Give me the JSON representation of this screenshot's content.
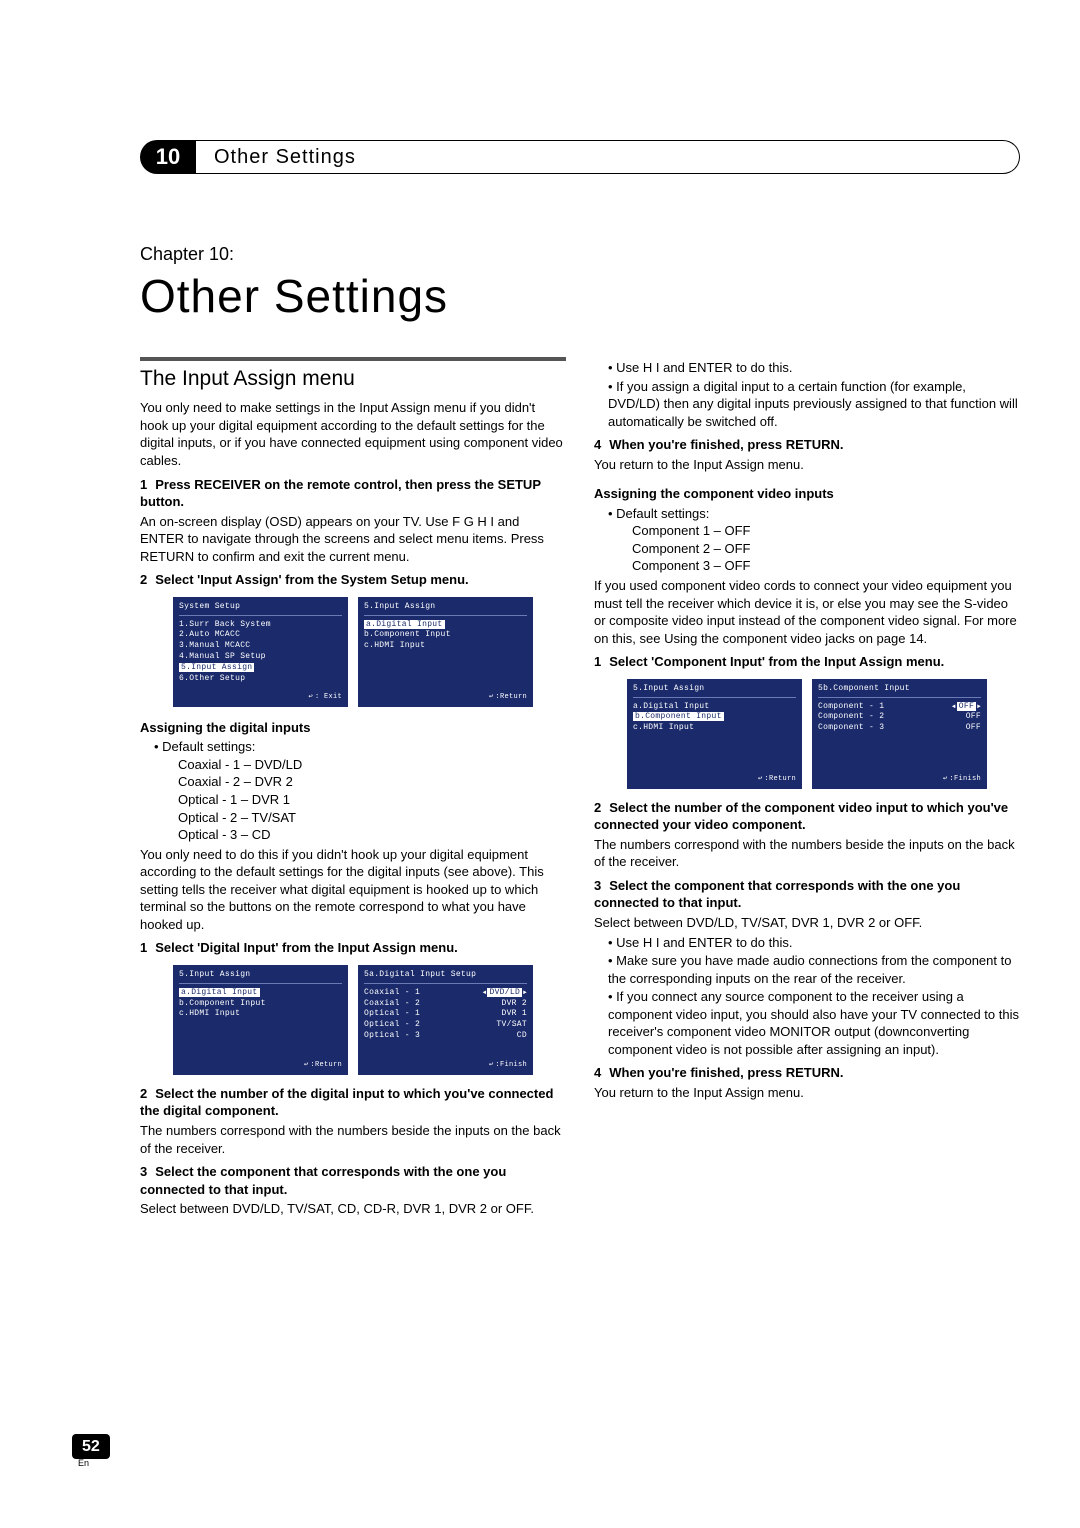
{
  "chapter": {
    "number": "10",
    "tab_label": "Other Settings",
    "pre": "Chapter 10:",
    "title": "Other Settings"
  },
  "left": {
    "section_title": "The Input Assign menu",
    "intro": "You only need to make settings in the Input Assign menu if you didn't hook up your digital equipment according to the default settings for the digital inputs, or if you have connected equipment using component video cables.",
    "step1_num": "1",
    "step1_text": "Press RECEIVER on the remote control, then press the SETUP button.",
    "step1_body": "An on-screen display (OSD) appears on your TV. Use F G H I and ENTER to navigate through the screens and select menu items. Press RETURN to confirm and exit the current menu.",
    "step2_num": "2",
    "step2_text": "Select 'Input Assign' from the System Setup menu.",
    "osd1a_title": "System Setup",
    "osd1a_lines": [
      "1.Surr Back System",
      "2.Auto MCACC",
      "3.Manual MCACC",
      "4.Manual SP Setup",
      "5.Input Assign",
      "6.Other Setup"
    ],
    "osd1a_footer": ": Exit",
    "osd1b_title": "5.Input Assign",
    "osd1b_lines": [
      "a.Digital Input",
      "b.Component Input",
      "c.HDMI Input"
    ],
    "osd1b_footer": ":Return",
    "sub1": "Assigning the digital inputs",
    "defaults_label": "Default settings:",
    "defaults": [
      "Coaxial - 1 – DVD/LD",
      "Coaxial - 2 – DVR 2",
      "Optical - 1 – DVR 1",
      "Optical - 2 – TV/SAT",
      "Optical - 3 – CD"
    ],
    "afterdef": "You only need to do this if you didn't hook up your digital equipment according to the default settings for the digital inputs (see above). This setting tells the receiver what digital equipment is hooked up to which terminal so the buttons on the remote correspond to what you have hooked up.",
    "dstep1_num": "1",
    "dstep1_text": "Select 'Digital Input' from the Input Assign menu.",
    "osd2a_title": "5.Input Assign",
    "osd2a_lines": [
      "a.Digital Input",
      "b.Component Input",
      "c.HDMI Input"
    ],
    "osd2a_footer": ":Return",
    "osd2b_title": "5a.Digital Input Setup",
    "osd2b_rows": [
      {
        "l": "Coaxial - 1",
        "r": "DVD/LD",
        "hl": true
      },
      {
        "l": "Coaxial - 2",
        "r": "DVR 2"
      },
      {
        "l": "Optical - 1",
        "r": "DVR 1"
      },
      {
        "l": "Optical - 2",
        "r": "TV/SAT"
      },
      {
        "l": "Optical - 3",
        "r": "CD"
      }
    ],
    "osd2b_footer": ":Finish",
    "dstep2_num": "2",
    "dstep2_text": "Select the number of the digital input to which you've connected the digital component.",
    "dstep2_body": "The numbers correspond with the numbers beside the inputs on the back of the receiver.",
    "dstep3_num": "3",
    "dstep3_text": "Select the component that corresponds with the one you connected to that input.",
    "dstep3_body": "Select between DVD/LD, TV/SAT, CD, CD-R, DVR 1, DVR 2 or OFF."
  },
  "right": {
    "bul1": "Use H I and ENTER to do this.",
    "bul2": "If you assign a digital input to a certain function (for example, DVD/LD) then any digital inputs previously assigned to that function will automatically be switched off.",
    "step4_num": "4",
    "step4_text": "When you're finished, press RETURN.",
    "step4_body": "You return to the Input Assign menu.",
    "sub2": "Assigning the component video inputs",
    "defaults_label": "Default settings:",
    "cdefaults": [
      "Component 1 – OFF",
      "Component 2 – OFF",
      "Component 3 – OFF"
    ],
    "cintro": "If you used component video cords to connect your video equipment you must tell the receiver which device it is, or else you may see the S-video or composite video input instead of the component video signal. For more on this, see Using the component video jacks on page 14.",
    "cstep1_num": "1",
    "cstep1_text": "Select 'Component Input' from the Input Assign menu.",
    "osd3a_title": "5.Input Assign",
    "osd3a_lines": [
      "a.Digital Input",
      "b.Component Input",
      "c.HDMI Input"
    ],
    "osd3a_footer": ":Return",
    "osd3b_title": "5b.Component Input",
    "osd3b_rows": [
      {
        "l": "Component - 1",
        "r": "OFF",
        "hl": true
      },
      {
        "l": "Component - 2",
        "r": "OFF"
      },
      {
        "l": "Component - 3",
        "r": "OFF"
      }
    ],
    "osd3b_footer": ":Finish",
    "cstep2_num": "2",
    "cstep2_text": "Select the number of the component video input to which you've connected your video component.",
    "cstep2_body": "The numbers correspond with the numbers beside the inputs on the back of the receiver.",
    "cstep3_num": "3",
    "cstep3_text": "Select the component that corresponds with the one you connected to that input.",
    "cstep3_body": "Select between DVD/LD, TV/SAT, DVR 1, DVR 2 or OFF.",
    "cbul1": "Use H I and ENTER to do this.",
    "cbul2": "Make sure you have made audio connections from the component to the corresponding inputs on the rear of the receiver.",
    "cbul3": "If you connect any source component to the receiver using a component video input, you should also have your TV connected to this receiver's component video MONITOR output (downconverting component video is not possible after assigning an input).",
    "cstep4_num": "4",
    "cstep4_text": "When you're finished, press RETURN.",
    "cstep4_body": "You return to the Input Assign menu."
  },
  "page": {
    "num": "52",
    "lang": "En"
  }
}
